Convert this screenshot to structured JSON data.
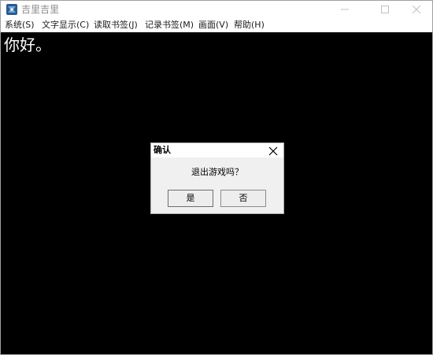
{
  "window": {
    "title": "吉里吉里",
    "icon": "app-icon"
  },
  "menu": {
    "items": [
      {
        "label": "系统(S)"
      },
      {
        "label": "文字显示(C)"
      },
      {
        "label": "读取书签(J)"
      },
      {
        "label": "记录书签(M)"
      },
      {
        "label": "画面(V)"
      },
      {
        "label": "帮助(H)"
      }
    ]
  },
  "game": {
    "text": "你好。"
  },
  "dialog": {
    "title": "确认",
    "message": "退出游戏吗？",
    "yes_label": "是",
    "no_label": "否"
  }
}
